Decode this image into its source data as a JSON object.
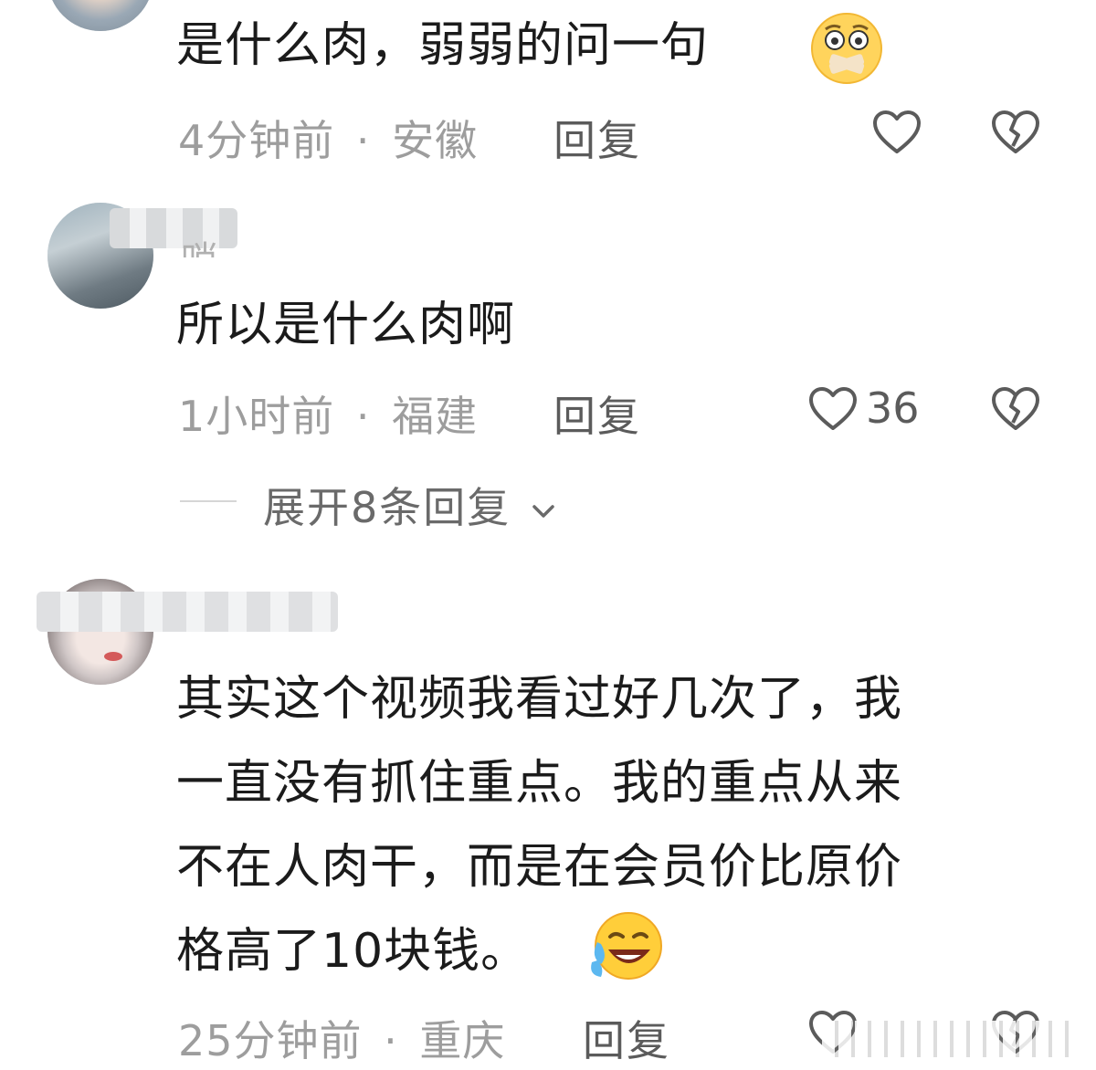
{
  "comments": [
    {
      "text": "是什么肉，弱弱的问一句",
      "time": "4分钟前",
      "separator": "·",
      "location": "安徽",
      "reply_label": "回复",
      "emoji_icon": "flushed-mouth-taped-emoji"
    },
    {
      "username_partial": "哨",
      "text": "所以是什么肉啊",
      "time": "1小时前",
      "separator": "·",
      "location": "福建",
      "reply_label": "回复",
      "like_count": "36",
      "expand_label": "展开8条回复"
    },
    {
      "text": "其实这个视频我看过好几次了，我\n一直没有抓住重点。我的重点从来\n不在人肉干，而是在会员价比原价\n格高了10块钱。",
      "time": "25分钟前",
      "separator": "·",
      "location": "重庆",
      "reply_label": "回复",
      "emoji_icon": "laughing-tears-emoji"
    }
  ],
  "colors": {
    "text": "#1b1b1b",
    "meta": "#9d9d9d",
    "action": "#5b5b5b"
  }
}
